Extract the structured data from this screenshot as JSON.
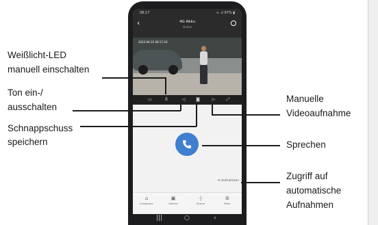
{
  "annotations": {
    "led": [
      "Weißlicht-LED",
      "manuell einschalten"
    ],
    "ton": [
      "Ton ein-/",
      "ausschalten"
    ],
    "snapshot": [
      "Schnappschuss",
      "speichern"
    ],
    "video": [
      "Manuelle",
      "Videoaufnahme"
    ],
    "sprechen": "Sprechen",
    "zugriff": [
      "Zugriff auf",
      "automatische",
      "Aufnahmen"
    ]
  },
  "app": {
    "status_time": "08:17",
    "status_battery": "≈ .ıl 97% ▮",
    "back_icon": "‹",
    "title": "4G Akku",
    "subtitle": "Online",
    "video_timestamp": "2023-06-22 08:17:20",
    "aufnahmen_label": "Aufnahmen",
    "nav": [
      {
        "icon": "⌂",
        "label": "Ereignisse"
      },
      {
        "icon": "▣",
        "label": "Galerie"
      },
      {
        "icon": "·|·",
        "label": "Sirene"
      },
      {
        "icon": "⊞",
        "label": "Mehr"
      }
    ]
  },
  "system": {
    "recent": "|||",
    "home": "○",
    "back": "‹"
  },
  "colors": {
    "call_button": "#3f7fcf",
    "phone_frame": "#1d1d1f"
  }
}
